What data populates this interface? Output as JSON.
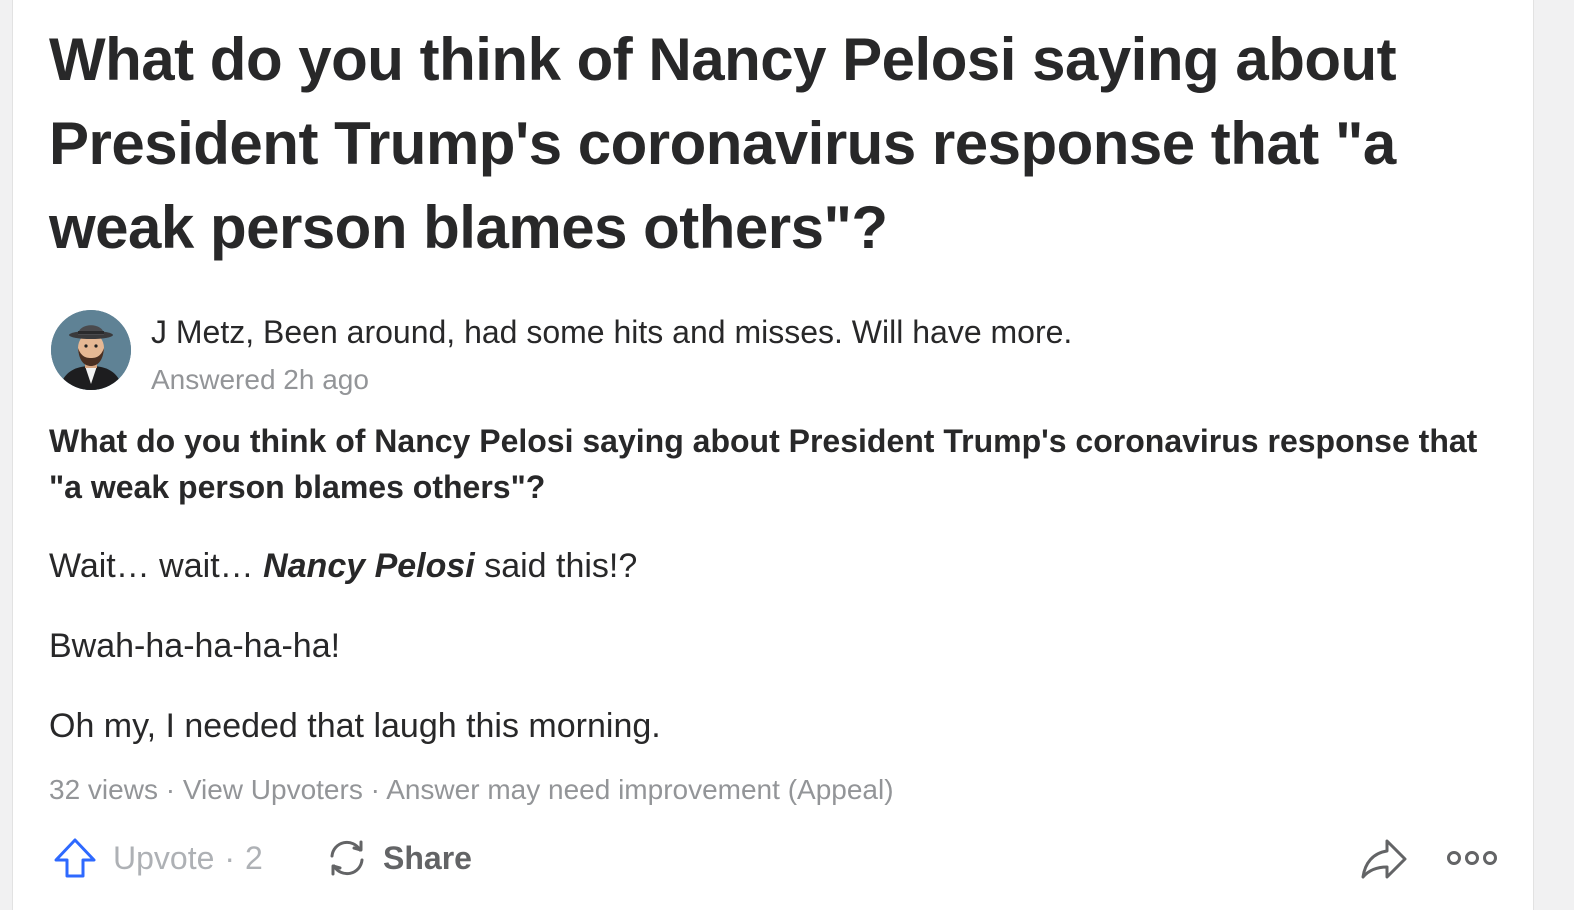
{
  "question": {
    "title": "What do you think of Nancy Pelosi saying about President Trump's coronavirus response that \"a weak person blames others\"?"
  },
  "author": {
    "credential_line": "J Metz, Been around, had some hits and misses. Will have more.",
    "answered": "Answered 2h ago",
    "avatar_icon": "avatar-man-in-fedora-icon"
  },
  "answer": {
    "question_repeat": "What do you think of Nancy Pelosi saying about President Trump's coronavirus response that \"a weak person blames others\"?",
    "p1_before": "Wait… wait… ",
    "p1_emphasis": "Nancy Pelosi",
    "p1_after": " said this!?",
    "p2": "Bwah-ha-ha-ha-ha!",
    "p3": "Oh my, I needed that laugh this morning."
  },
  "stats": {
    "views": "32 views",
    "sep": " · ",
    "view_upvoters": "View Upvoters",
    "improvement": "Answer may need improvement",
    "appeal": "(Appeal)"
  },
  "actions": {
    "upvote_label": "Upvote",
    "upvote_sep": "·",
    "upvote_count": "2",
    "share_label": "Share",
    "upvote_icon": "upvote-arrow-icon",
    "share_icon": "refresh-share-icon",
    "share_arrow_icon": "share-arrow-icon",
    "more_icon": "more-options-icon"
  },
  "colors": {
    "text": "#282829",
    "muted": "#939598",
    "upvote_blue": "#2e69ff",
    "upvote_text": "#aeb1b5"
  }
}
